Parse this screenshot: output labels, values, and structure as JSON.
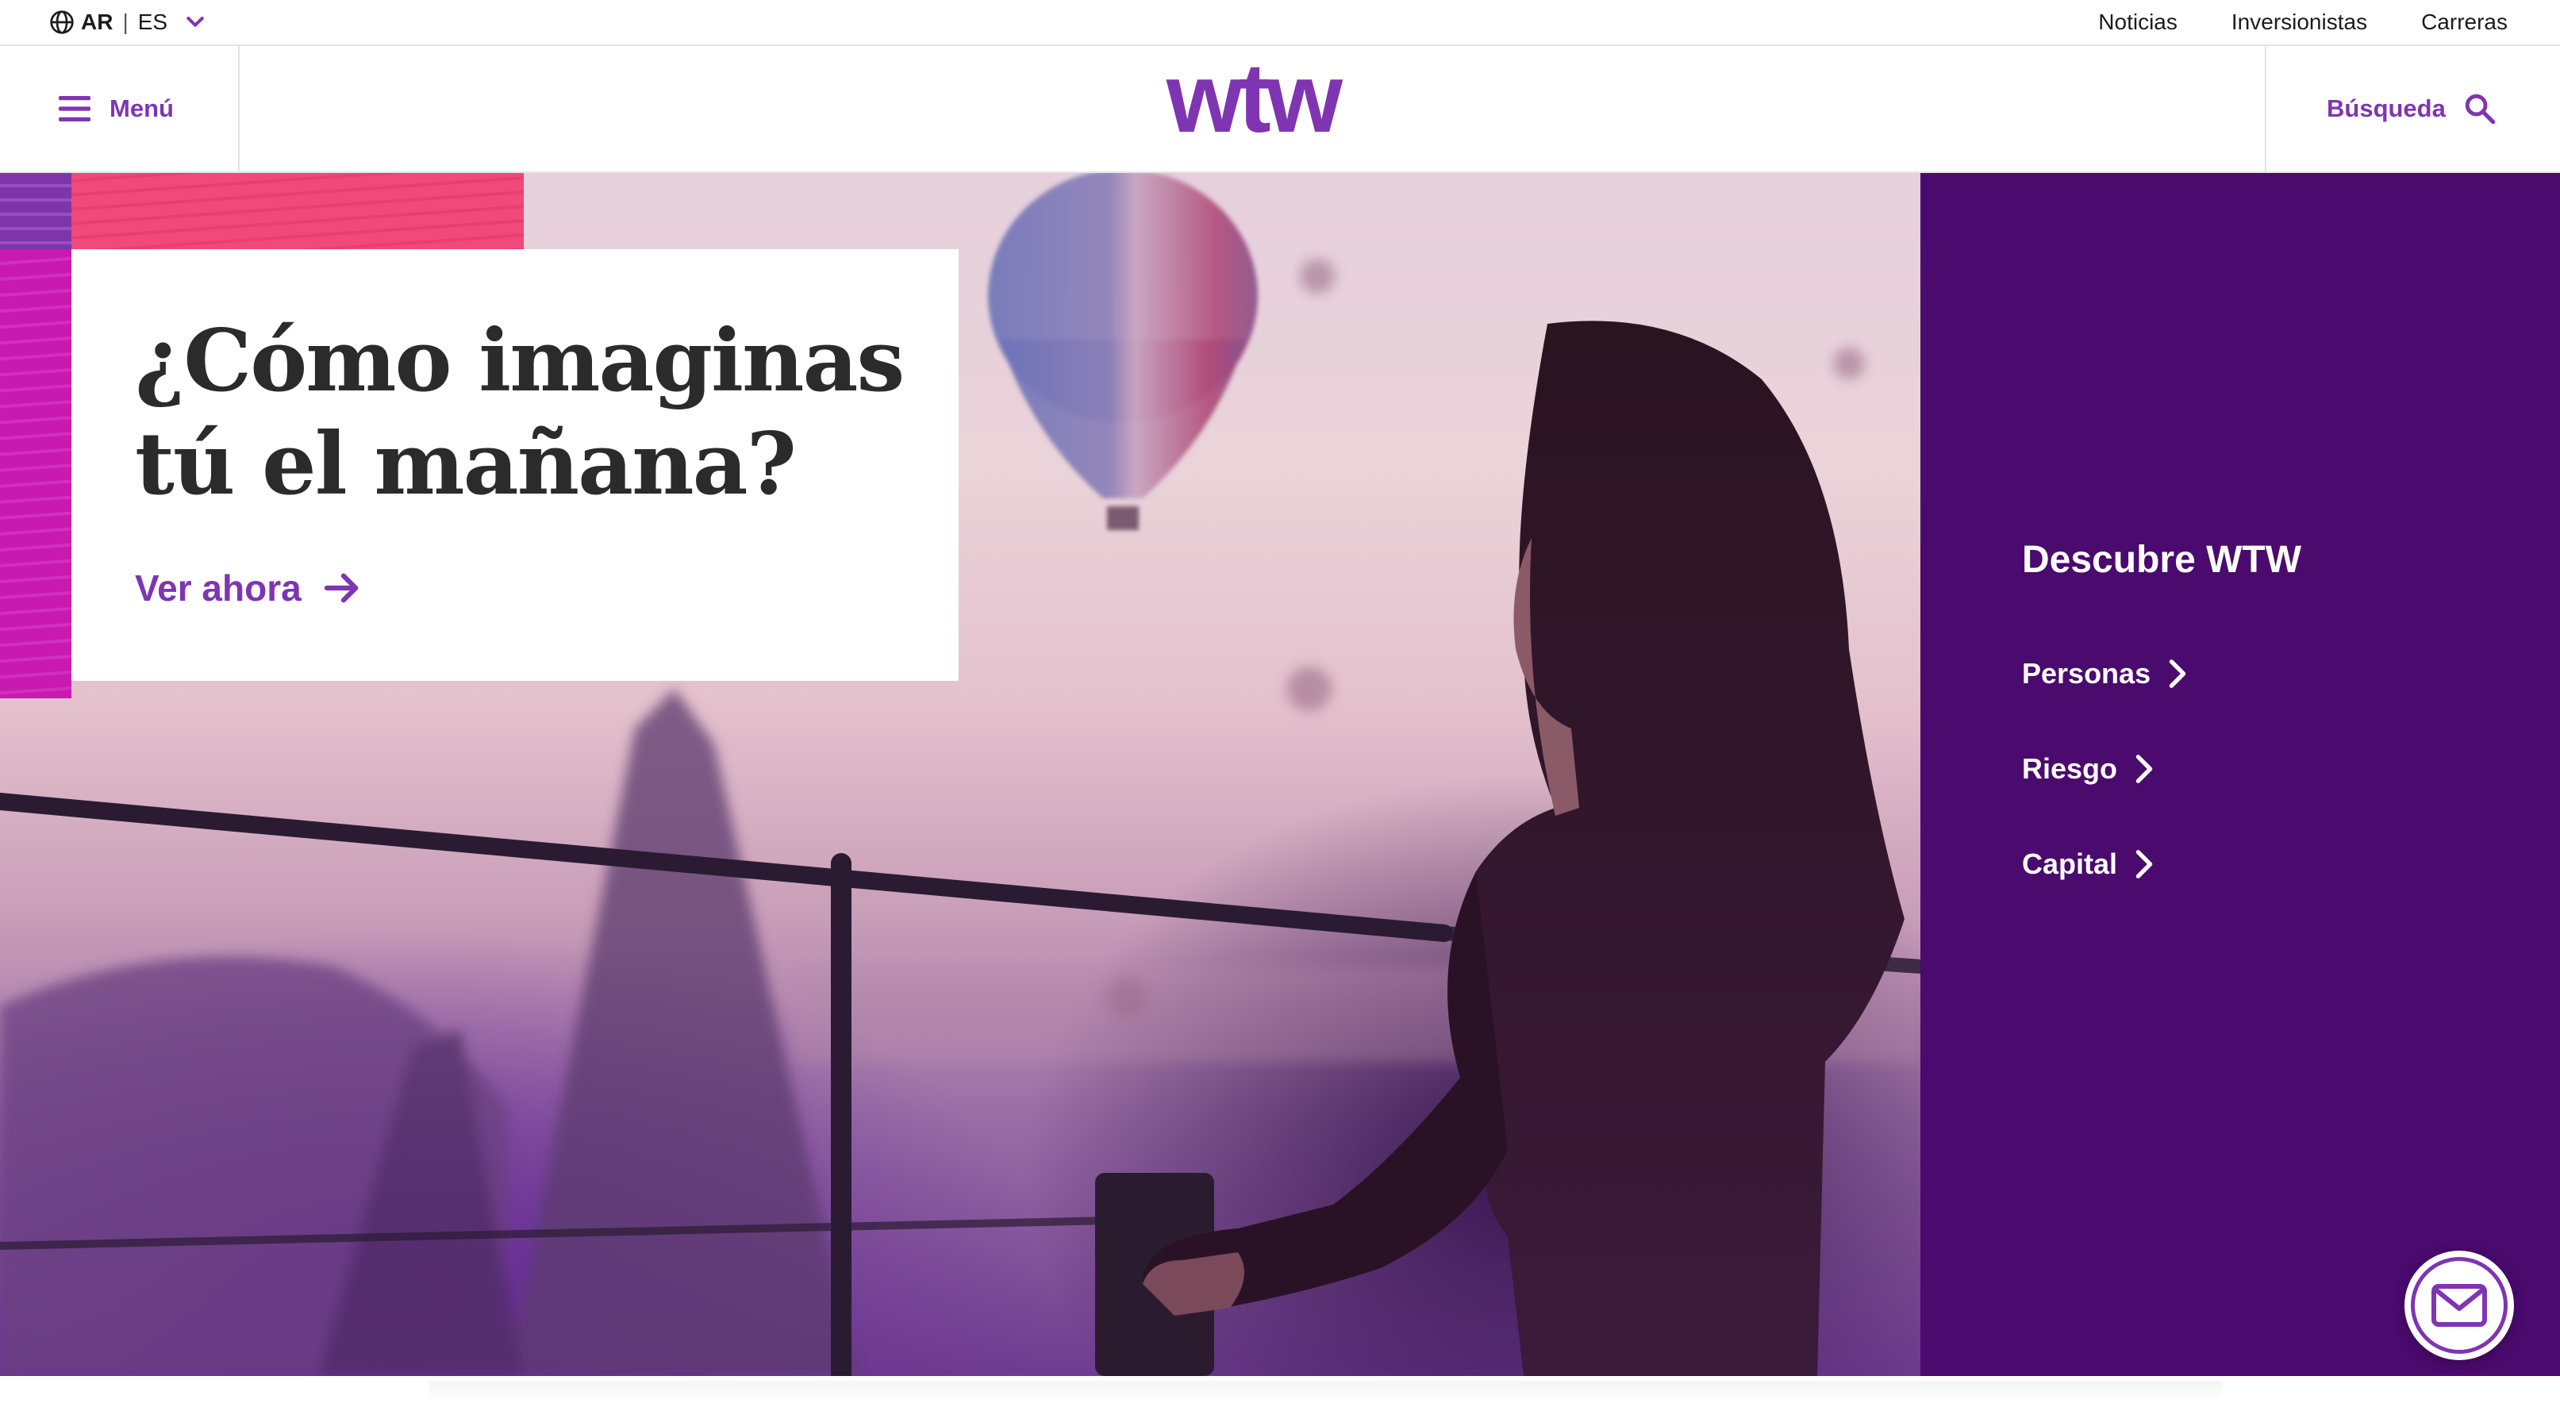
{
  "utility_bar": {
    "region": "AR",
    "language": "ES",
    "links": [
      "Noticias",
      "Inversionistas",
      "Carreras"
    ]
  },
  "header": {
    "menu_label": "Menú",
    "logo_text": "wtw",
    "search_label": "Búsqueda"
  },
  "hero": {
    "headline": "¿Cómo imaginas tú el mañana?",
    "cta_label": "Ver ahora"
  },
  "discover": {
    "title": "Descubre WTW",
    "items": [
      "Personas",
      "Riesgo",
      "Capital"
    ]
  },
  "icons": {
    "globe": "globe-icon",
    "language_dropdown": "chevron-down-icon",
    "menu": "hamburger-icon",
    "search": "search-icon",
    "cta_arrow": "arrow-right-icon",
    "discover_chevron": "chevron-right-icon",
    "mail": "mail-icon"
  },
  "colors": {
    "brand_purple": "#7f35b2",
    "panel_purple": "#4a0a6e",
    "accent_pink": "#f0497a",
    "accent_magenta": "#c81ab0"
  }
}
